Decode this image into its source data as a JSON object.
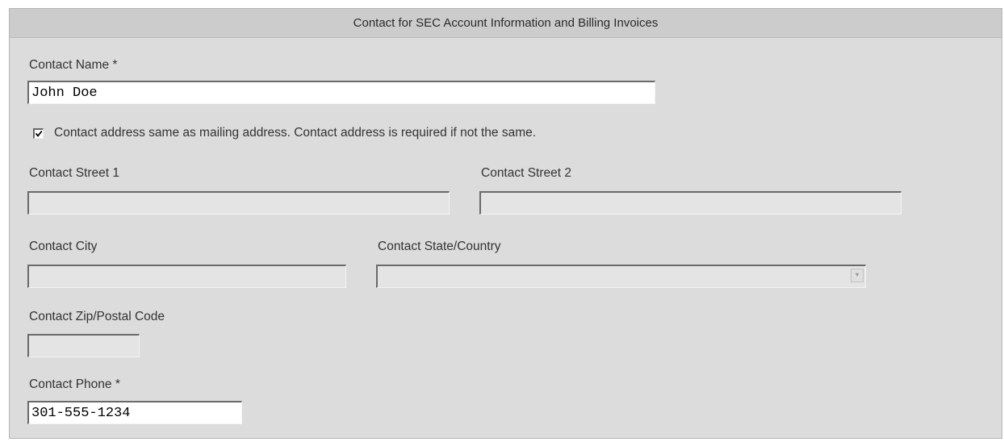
{
  "section": {
    "title": "Contact for SEC Account Information and Billing Invoices"
  },
  "contact_name": {
    "label": "Contact Name *",
    "value": "John Doe"
  },
  "same_address": {
    "label": "Contact address same as mailing address. Contact address is required if not the same.",
    "checked": true
  },
  "street1": {
    "label": "Contact Street 1",
    "value": ""
  },
  "street2": {
    "label": "Contact Street 2",
    "value": ""
  },
  "city": {
    "label": "Contact City",
    "value": ""
  },
  "state_country": {
    "label": "Contact State/Country",
    "value": "",
    "icon": "chevron-down-icon"
  },
  "zip": {
    "label": "Contact Zip/Postal Code",
    "value": ""
  },
  "phone": {
    "label": "Contact Phone *",
    "value": "301-555-1234"
  }
}
